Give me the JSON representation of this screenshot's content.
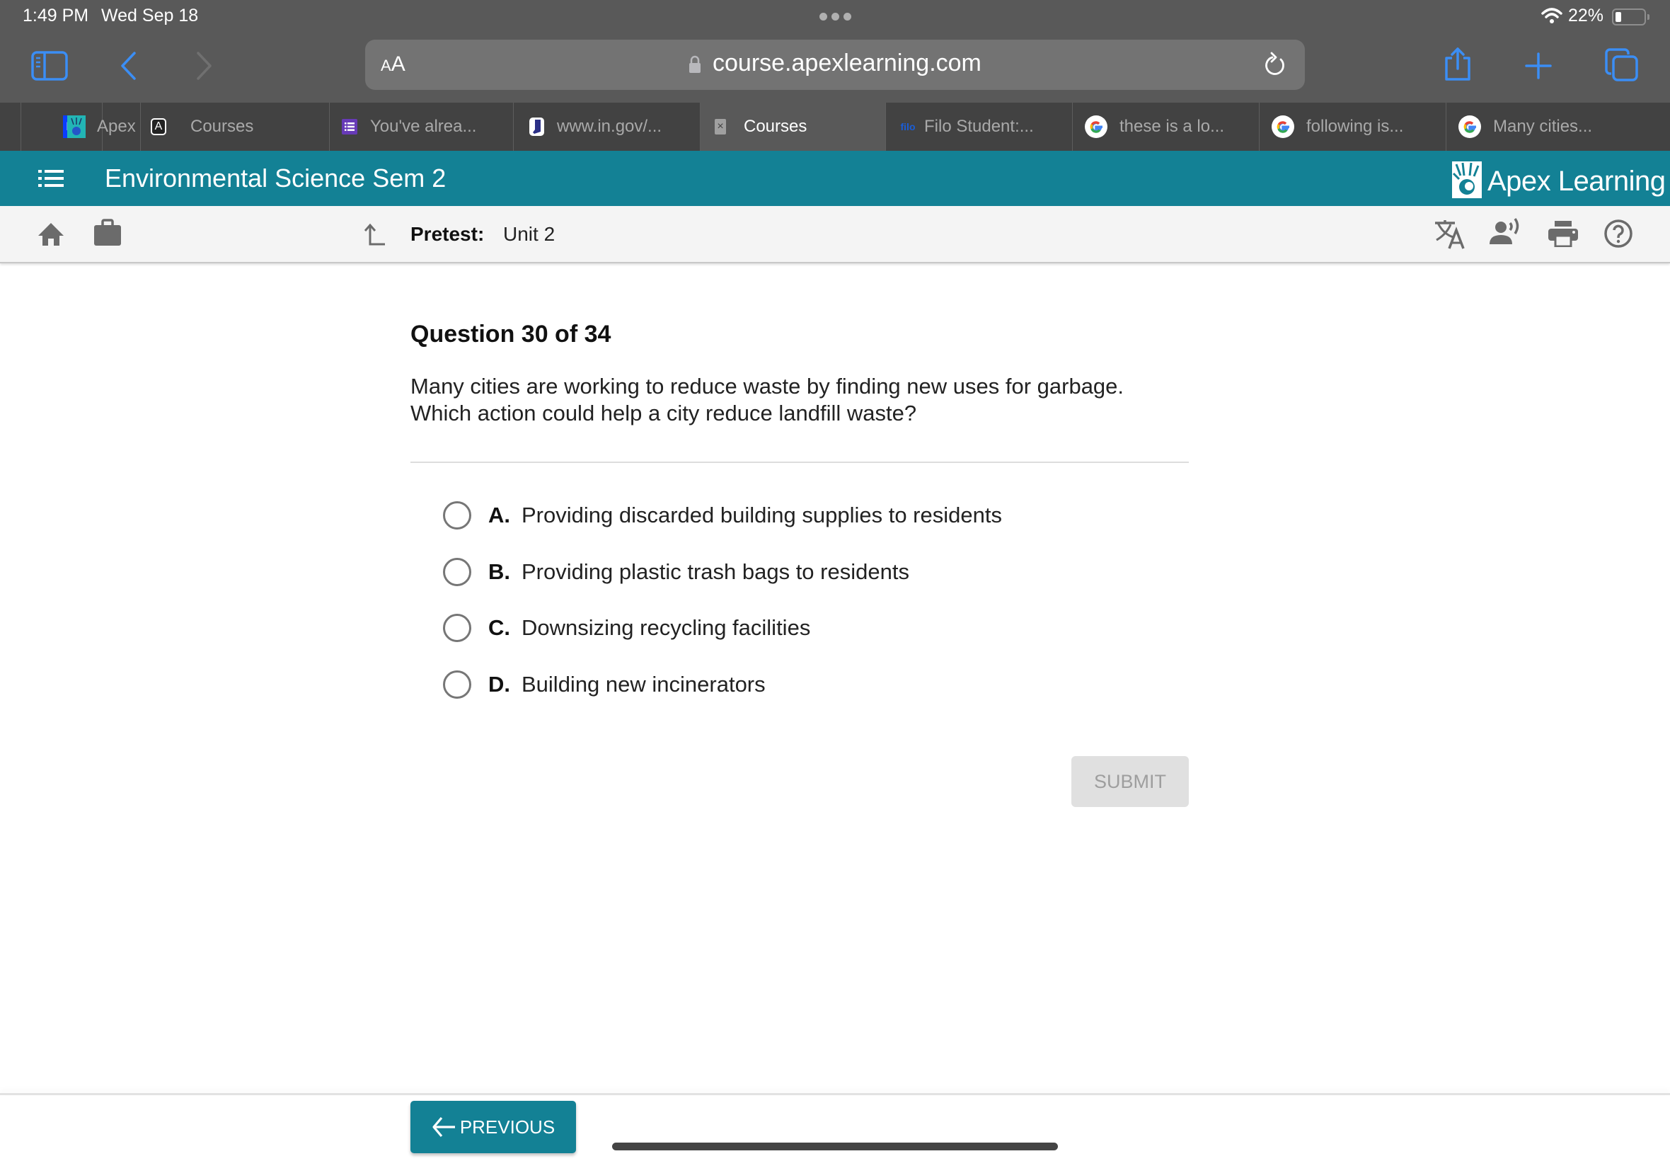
{
  "status_bar": {
    "time": "1:49 PM",
    "date": "Wed Sep 18",
    "battery": "22%",
    "battery_level": 0.22,
    "icons": [
      "wifi-icon",
      "battery-icon"
    ]
  },
  "browser": {
    "text_size_label": "AA",
    "url": "course.apexlearning.com",
    "toolbar_icons": [
      "sidebar-icon",
      "back-icon",
      "forward-icon",
      "lock-icon",
      "reload-icon",
      "share-icon",
      "new-tab-icon",
      "tabs-overview-icon"
    ],
    "accent_color": "#3b8ef5"
  },
  "tabs": [
    {
      "label": "",
      "favicon": "BI",
      "favicon_color": "#0a3cff",
      "active": false
    },
    {
      "label": "Apex",
      "favicon": "apex-logo-icon",
      "favicon_color": "#22b5b5",
      "active": false
    },
    {
      "label": "Courses",
      "favicon": "A",
      "favicon_color": "#222222",
      "active": false
    },
    {
      "label": "You've alrea...",
      "favicon": "list-icon",
      "favicon_color": "#673ab7",
      "active": false
    },
    {
      "label": "www.in.gov/...",
      "favicon": "indiana-icon",
      "favicon_color": "#ffffff",
      "active": false
    },
    {
      "label": "Courses",
      "favicon": "close-icon",
      "favicon_color": "#a0a0a0",
      "active": true
    },
    {
      "label": "Filo Student:...",
      "favicon": "filo",
      "favicon_color": "#1a5dd6",
      "active": false
    },
    {
      "label": "these is a lo...",
      "favicon": "google-icon",
      "favicon_color": "#ffffff",
      "active": false
    },
    {
      "label": "following is...",
      "favicon": "google-icon",
      "favicon_color": "#ffffff",
      "active": false
    },
    {
      "label": "Many cities...",
      "favicon": "google-icon",
      "favicon_color": "#ffffff",
      "active": false
    }
  ],
  "header": {
    "course_title": "Environmental Science Sem 2",
    "brand": "Apex Learning",
    "brand_color": "#138195"
  },
  "subbar": {
    "label": "Pretest:",
    "unit": "Unit 2",
    "left_icons": [
      "home-icon",
      "briefcase-icon"
    ],
    "right_icons": [
      "translate-icon",
      "text-to-speech-icon",
      "print-icon",
      "help-icon"
    ]
  },
  "question": {
    "title": "Question 30 of 34",
    "text_line1": "Many cities are working to reduce waste by finding new uses for garbage.",
    "text_line2": "Which action could help a city reduce landfill waste?",
    "options": [
      {
        "letter": "A.",
        "text": "Providing discarded building supplies to residents",
        "selected": false
      },
      {
        "letter": "B.",
        "text": "Providing plastic trash bags to residents",
        "selected": false
      },
      {
        "letter": "C.",
        "text": "Downsizing recycling facilities",
        "selected": false
      },
      {
        "letter": "D.",
        "text": "Building new incinerators",
        "selected": false
      }
    ],
    "submit_label": "SUBMIT",
    "submit_enabled": false
  },
  "footer": {
    "previous_label": "PREVIOUS"
  }
}
